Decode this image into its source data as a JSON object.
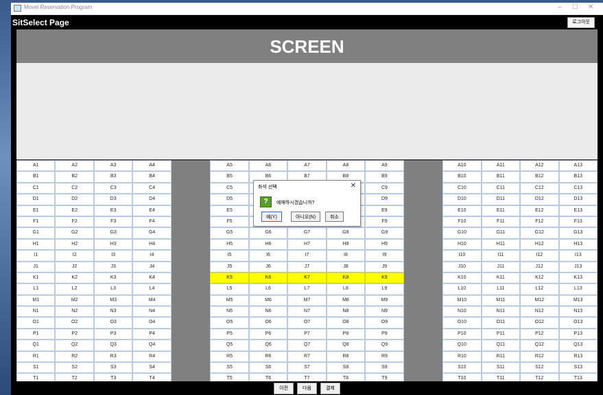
{
  "window": {
    "title": "Movei Reservation Program",
    "minimize": "–",
    "maximize": "☐",
    "close": "✕"
  },
  "header": {
    "page_title": "SitSelect Page",
    "logout_label": "로그아웃"
  },
  "screen": {
    "label": "SCREEN"
  },
  "seating": {
    "rows": [
      "A",
      "B",
      "C",
      "D",
      "E",
      "F",
      "G",
      "H",
      "I",
      "J",
      "K",
      "L",
      "M",
      "N",
      "O",
      "P",
      "Q",
      "R",
      "S",
      "T"
    ],
    "columns": [
      1,
      2,
      3,
      4,
      null,
      5,
      6,
      7,
      8,
      9,
      null,
      10,
      11,
      12,
      13
    ],
    "selected_seats": [
      "K5",
      "K6",
      "K7",
      "K8",
      "K9"
    ],
    "selected_color": "#ffff00",
    "aisle_color": "#808080"
  },
  "dialog": {
    "title": "좌석 선택",
    "close_icon": "close-icon",
    "icon": "question-icon",
    "icon_glyph": "?",
    "message": "예매하시겠습니까?",
    "yes_label": "예(Y)",
    "no_label": "아니오(N)",
    "cancel_label": "취소"
  },
  "footer": {
    "prev_label": "이전",
    "next_label": "다음",
    "pay_label": "결제"
  }
}
